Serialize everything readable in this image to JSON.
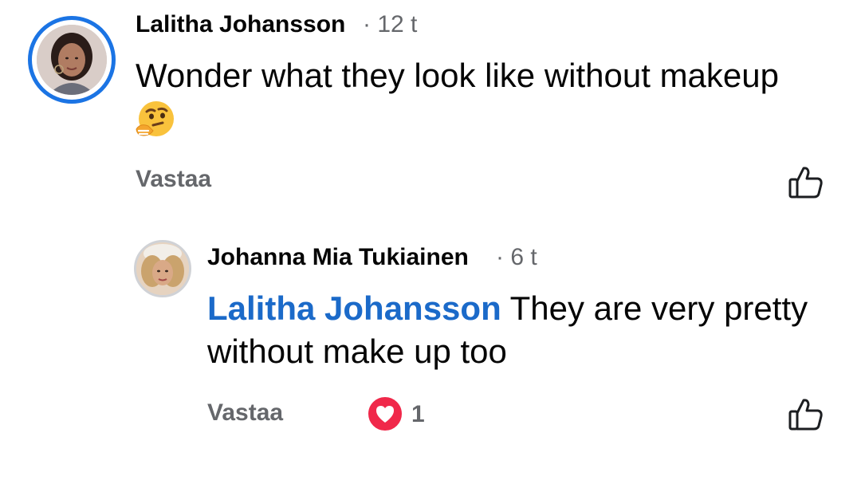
{
  "comments": [
    {
      "author": "Lalitha Johansson",
      "time": "· 12 t",
      "text": "Wonder what they look like without makeup",
      "emoji": "thinking-face",
      "reply_label": "Vastaa"
    }
  ],
  "replies": [
    {
      "author": "Johanna Mia Tukiainen",
      "time": "· 6 t",
      "mention": "Lalitha Johansson",
      "text": " They are very pretty without make up too",
      "reply_label": "Vastaa",
      "reaction_icon": "heart-reaction",
      "reaction_count": "1"
    }
  ],
  "icons": {
    "like": "thumbs-up-outline-icon"
  },
  "colors": {
    "story_ring": "#1b74e4",
    "mention": "#1b6ac9",
    "secondary_text": "#65676b",
    "heart": "#f0284a"
  }
}
